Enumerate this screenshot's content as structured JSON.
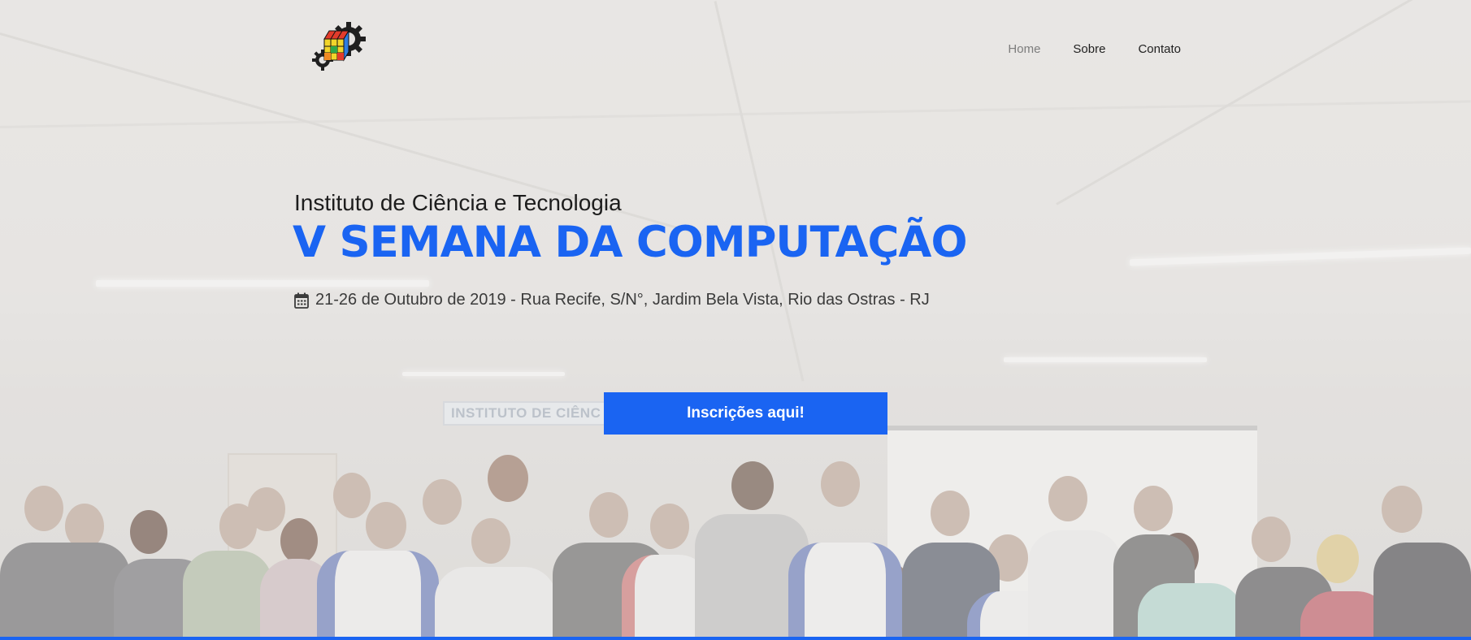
{
  "header": {
    "logo_icon": "rubiks-cube-gear-icon",
    "nav": [
      {
        "label": "Home",
        "active": true
      },
      {
        "label": "Sobre",
        "active": false
      },
      {
        "label": "Contato",
        "active": false
      }
    ]
  },
  "hero": {
    "subtitle": "Instituto de Ciência e Tecnologia",
    "title": "V SEMANA DA COMPUTAÇÃO",
    "event_icon": "calendar-icon",
    "event_info": "21-26 de Outubro de 2019 - Rua Recife, S/N°, Jardim Bela Vista, Rio das Ostras - RJ",
    "cta_label": "Inscrições aqui!",
    "wall_sign": "INSTITUTO DE CIÊNC"
  },
  "colors": {
    "accent": "#1a64f2",
    "text": "#1d1d1d",
    "nav_active": "#7d7d7d"
  }
}
